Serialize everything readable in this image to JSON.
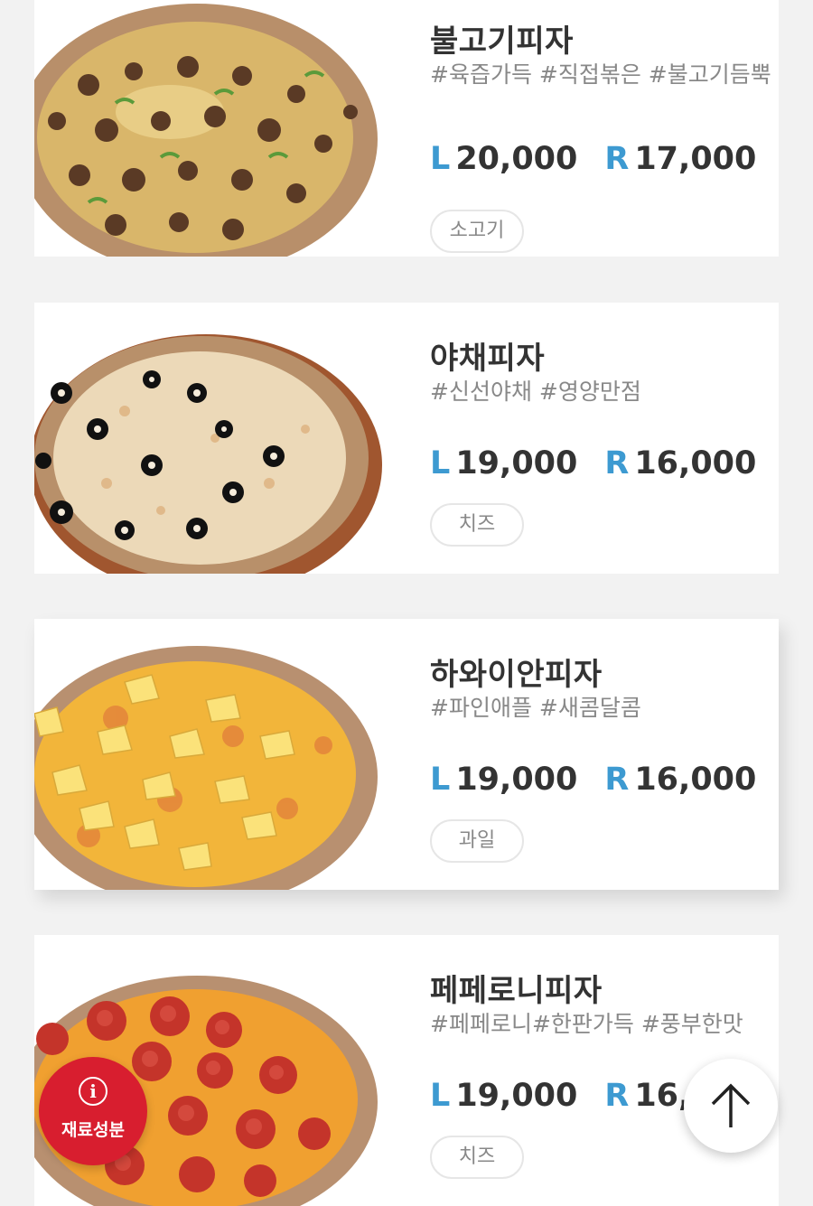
{
  "menu": [
    {
      "name": "불고기피자",
      "tags": "#육즙가득 #직접볶은 #불고기듬뿍",
      "price_l_label": "L",
      "price_l": "20,000",
      "price_r_label": "R",
      "price_r": "17,000",
      "category": "소고기"
    },
    {
      "name": "야채피자",
      "tags": "#신선야채 #영양만점",
      "price_l_label": "L",
      "price_l": "19,000",
      "price_r_label": "R",
      "price_r": "16,000",
      "category": "치즈"
    },
    {
      "name": "하와이안피자",
      "tags": "#파인애플 #새콤달콤",
      "price_l_label": "L",
      "price_l": "19,000",
      "price_r_label": "R",
      "price_r": "16,000",
      "category": "과일"
    },
    {
      "name": "페페로니피자",
      "tags": "#페페로니#한판가득 #풍부한맛",
      "price_l_label": "L",
      "price_l": "19,000",
      "price_r_label": "R",
      "price_r": "16,000",
      "category": "치즈"
    }
  ],
  "floating": {
    "ingredients_label": "재료성분",
    "info_glyph": "i"
  },
  "colors": {
    "price_label": "#3d9ad1",
    "ingredients_button": "#d81e2f"
  },
  "icons": {
    "ingredients": "info-icon",
    "scroll_top": "arrow-up-icon"
  }
}
